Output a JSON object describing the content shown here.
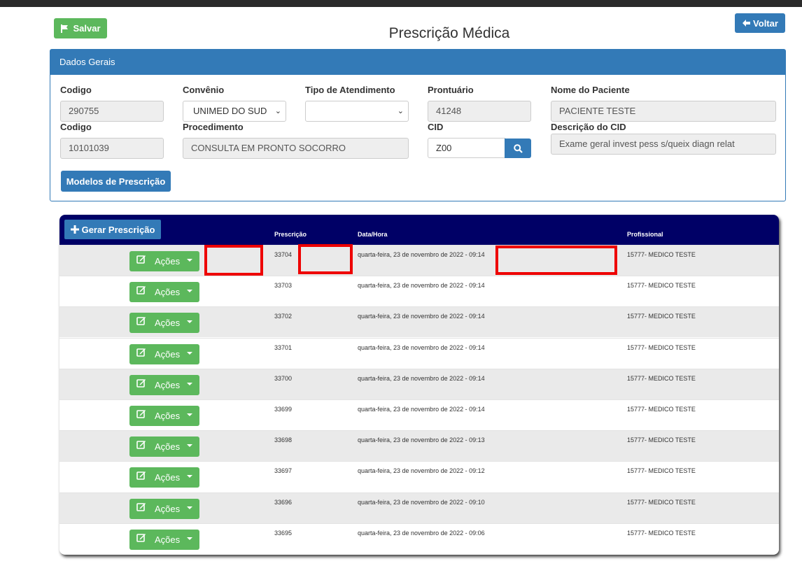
{
  "header": {
    "save_label": "Salvar",
    "back_label": "Voltar",
    "title": "Prescrição Médica"
  },
  "panel": {
    "title": "Dados Gerais",
    "row1": {
      "codigo_label": "Codigo",
      "codigo_value": "290755",
      "convenio_label": "Convênio",
      "convenio_value": "UNIMED DO SUD",
      "tipo_label": "Tipo de Atendimento",
      "tipo_value": "",
      "prontuario_label": "Prontuário",
      "prontuario_value": "41248",
      "paciente_label": "Nome do Paciente",
      "paciente_value": "PACIENTE TESTE"
    },
    "row2": {
      "codigo_label": "Codigo",
      "codigo_value": "10101039",
      "procedimento_label": "Procedimento",
      "procedimento_value": "CONSULTA EM PRONTO SOCORRO",
      "cid_label": "CID",
      "cid_value": "Z00",
      "descricao_label": "Descrição do CID",
      "descricao_value": "Exame geral invest pess s/queix diagn relat"
    },
    "models_button": "Modelos de Prescrição"
  },
  "grid": {
    "generate_button": "Gerar Prescrição",
    "columns": [
      "Prescrição",
      "Data/Hora",
      "Profissional"
    ],
    "actions_label": "Ações",
    "rows": [
      {
        "prescricao": "33704",
        "datahora": "quarta-feira, 23 de novembro de 2022 - 09:14",
        "profissional": "15777- MEDICO TESTE"
      },
      {
        "prescricao": "33703",
        "datahora": "quarta-feira, 23 de novembro de 2022 - 09:14",
        "profissional": "15777- MEDICO TESTE"
      },
      {
        "prescricao": "33702",
        "datahora": "quarta-feira, 23 de novembro de 2022 - 09:14",
        "profissional": "15777- MEDICO TESTE"
      },
      {
        "prescricao": "33701",
        "datahora": "quarta-feira, 23 de novembro de 2022 - 09:14",
        "profissional": "15777- MEDICO TESTE"
      },
      {
        "prescricao": "33700",
        "datahora": "quarta-feira, 23 de novembro de 2022 - 09:14",
        "profissional": "15777- MEDICO TESTE"
      },
      {
        "prescricao": "33699",
        "datahora": "quarta-feira, 23 de novembro de 2022 - 09:14",
        "profissional": "15777- MEDICO TESTE"
      },
      {
        "prescricao": "33698",
        "datahora": "quarta-feira, 23 de novembro de 2022 - 09:13",
        "profissional": "15777- MEDICO TESTE"
      },
      {
        "prescricao": "33697",
        "datahora": "quarta-feira, 23 de novembro de 2022 - 09:12",
        "profissional": "15777- MEDICO TESTE"
      },
      {
        "prescricao": "33696",
        "datahora": "quarta-feira, 23 de novembro de 2022 - 09:10",
        "profissional": "15777- MEDICO TESTE"
      },
      {
        "prescricao": "33695",
        "datahora": "quarta-feira, 23 de novembro de 2022 - 09:06",
        "profissional": "15777- MEDICO TESTE"
      }
    ]
  },
  "colors": {
    "primary": "#337ab7",
    "success": "#5cb85c",
    "grid_header": "#000066",
    "annotation_red": "#ee0000"
  }
}
